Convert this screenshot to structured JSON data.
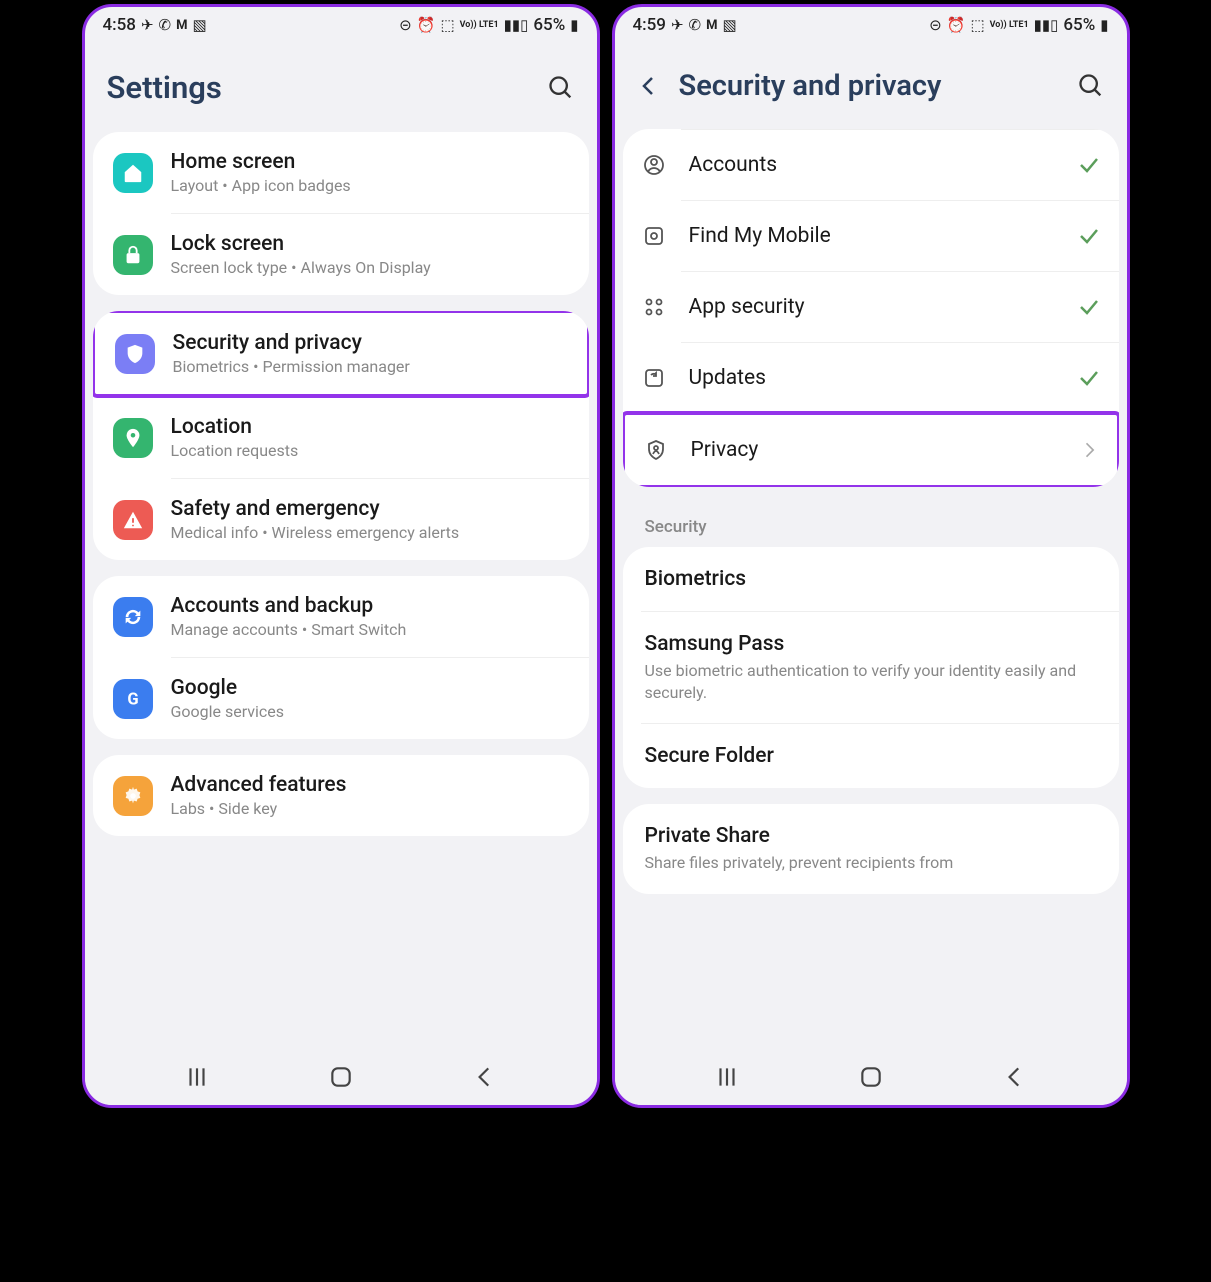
{
  "left": {
    "status": {
      "time": "4:58",
      "battery": "65%"
    },
    "title": "Settings",
    "cards": [
      {
        "items": [
          {
            "title": "Home screen",
            "sub": "Layout  •  App icon badges",
            "color": "ic-teal",
            "icon": "home"
          },
          {
            "title": "Lock screen",
            "sub": "Screen lock type  •  Always On Display",
            "color": "ic-green",
            "icon": "lock"
          }
        ]
      },
      {
        "items": [
          {
            "title": "Security and privacy",
            "sub": "Biometrics  •  Permission manager",
            "color": "ic-purple",
            "icon": "shield",
            "hl": true
          },
          {
            "title": "Location",
            "sub": "Location requests",
            "color": "ic-green2",
            "icon": "pin"
          },
          {
            "title": "Safety and emergency",
            "sub": "Medical info  •  Wireless emergency alerts",
            "color": "ic-red",
            "icon": "alert"
          }
        ]
      },
      {
        "items": [
          {
            "title": "Accounts and backup",
            "sub": "Manage accounts  •  Smart Switch",
            "color": "ic-blue",
            "icon": "sync"
          },
          {
            "title": "Google",
            "sub": "Google services",
            "color": "ic-blue2",
            "icon": "g"
          }
        ]
      },
      {
        "items": [
          {
            "title": "Advanced features",
            "sub": "Labs  •  Side key",
            "color": "ic-orange",
            "icon": "gear"
          }
        ]
      }
    ]
  },
  "right": {
    "status": {
      "time": "4:59",
      "battery": "65%"
    },
    "title": "Security and privacy",
    "dashboard": [
      {
        "title": "Accounts",
        "icon": "user",
        "trail": "check"
      },
      {
        "title": "Find My Mobile",
        "icon": "locate",
        "trail": "check"
      },
      {
        "title": "App security",
        "icon": "grid",
        "trail": "check"
      },
      {
        "title": "Updates",
        "icon": "refresh",
        "trail": "check"
      },
      {
        "title": "Privacy",
        "icon": "priv",
        "trail": "chev",
        "hl": true
      }
    ],
    "section_label": "Security",
    "security_items": [
      {
        "title": "Biometrics"
      },
      {
        "title": "Samsung Pass",
        "sub": "Use biometric authentication to verify your identity easily and securely."
      },
      {
        "title": "Secure Folder"
      }
    ],
    "share_items": [
      {
        "title": "Private Share",
        "sub": "Share files privately, prevent recipients from"
      }
    ]
  }
}
